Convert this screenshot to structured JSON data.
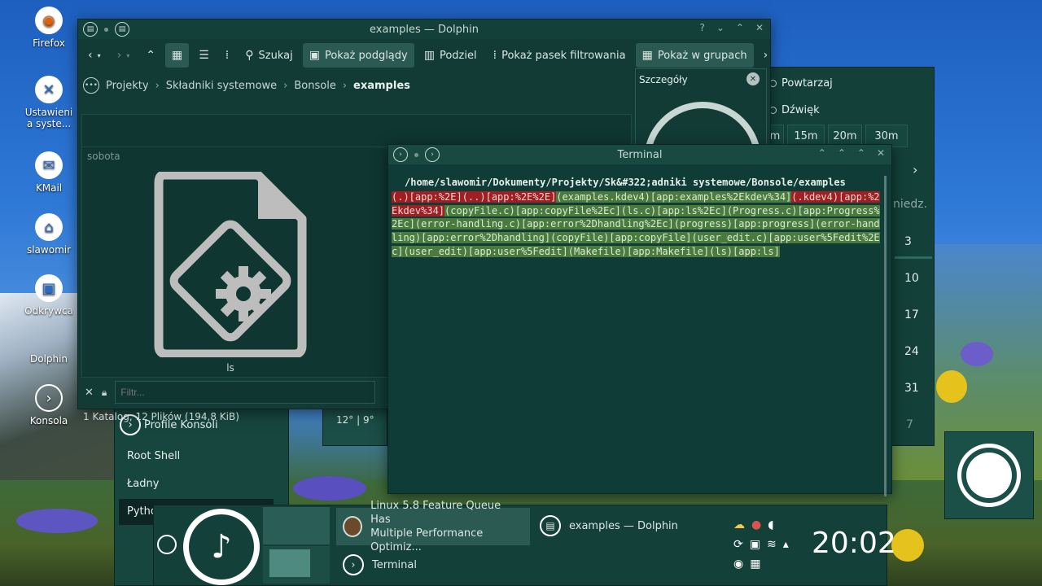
{
  "desktop": {
    "icons": [
      {
        "label": "Firefox",
        "icon": "firefox-icon",
        "glyph": "◉"
      },
      {
        "label": "Ustawienia systemu",
        "icon": "settings-icon",
        "glyph": "✕"
      },
      {
        "label": "KMail",
        "icon": "kmail-icon",
        "glyph": "✉"
      },
      {
        "label": "slawomir",
        "icon": "home-icon",
        "glyph": "⌂"
      },
      {
        "label": "Odkrywca",
        "icon": "discover-icon",
        "glyph": "▣"
      },
      {
        "label": "Dolphin",
        "icon": "dolphin-icon",
        "glyph": "▤"
      },
      {
        "label": "Konsola",
        "icon": "konsole-icon",
        "glyph": "›"
      }
    ],
    "icon_lines": {
      "ustawienia_1": "Ustawieni",
      "ustawienia_2": "a syste..."
    }
  },
  "dolphin": {
    "title": "examples — Dolphin",
    "toolbar": {
      "search": "Szukaj",
      "preview": "Pokaż podglądy",
      "split": "Podziel",
      "filterbar": "Pokaż pasek filtrowania",
      "groups": "Pokaż w grupach"
    },
    "breadcrumb": [
      "Projekty",
      "Składniki systemowe",
      "Bonsole",
      "examples"
    ],
    "group_label": "sobota",
    "file_name": "ls",
    "filter_placeholder": "Filtr...",
    "status": "1 Katalog, 12 Plików (194,8 KiB)",
    "details_title": "Szczegóły"
  },
  "terminal": {
    "title": "Terminal",
    "path_line": "/home/slawomir/Dokumenty/Projekty/Sk&#322;adniki systemowe/Bonsole/examples",
    "segments": [
      {
        "text": "(.)[app:%2E](..)[app:%2E%2E]",
        "style": "red"
      },
      {
        "text": "(examples.kdev4)[app:examples%2Ekdev%34]",
        "style": "green"
      },
      {
        "text": "(.kdev4)[app:%2Ekdev%34]",
        "style": "red"
      },
      {
        "text": "(copyFile.c)[app:copyFile%2Ec](ls.c)[app:ls%2Ec](Progress.c)[app:Progress%2Ec](error-handling.c)[app:error%2Dhandling%2Ec](progress)[app:progress](error-handling)[app:error%2Dhandling](copyFile)[app:copyFile](user_edit.c)[app:user%5Fedit%2Ec](user_edit)[app:user%5Fedit](Makefile)[app:Makefile](ls)[app:ls]",
        "style": "green"
      }
    ]
  },
  "alarm_widget": {
    "repeat": "Powtarzaj",
    "sound": "Dźwięk",
    "durations": [
      "m",
      "15m",
      "20m",
      "30m"
    ]
  },
  "calendar": {
    "header": "niedz.",
    "days": [
      "3",
      "10",
      "17",
      "24",
      "31",
      "7"
    ]
  },
  "weather": {
    "temps": "12° | 9°"
  },
  "konsole_profiles": {
    "title": "Profile Konsoli",
    "items": [
      "Root Shell",
      "Ładny",
      "Pytho"
    ]
  },
  "taskbar": {
    "tasks": [
      {
        "label": "Linux 5.8 Feature Queue Has Multiple Performance Optimiz...",
        "line1": "Linux 5.8 Feature Queue Has",
        "line2": "Multiple Performance Optimiz..."
      },
      {
        "label": "examples — Dolphin"
      },
      {
        "label": "Terminal"
      }
    ],
    "clock": "20:02"
  }
}
